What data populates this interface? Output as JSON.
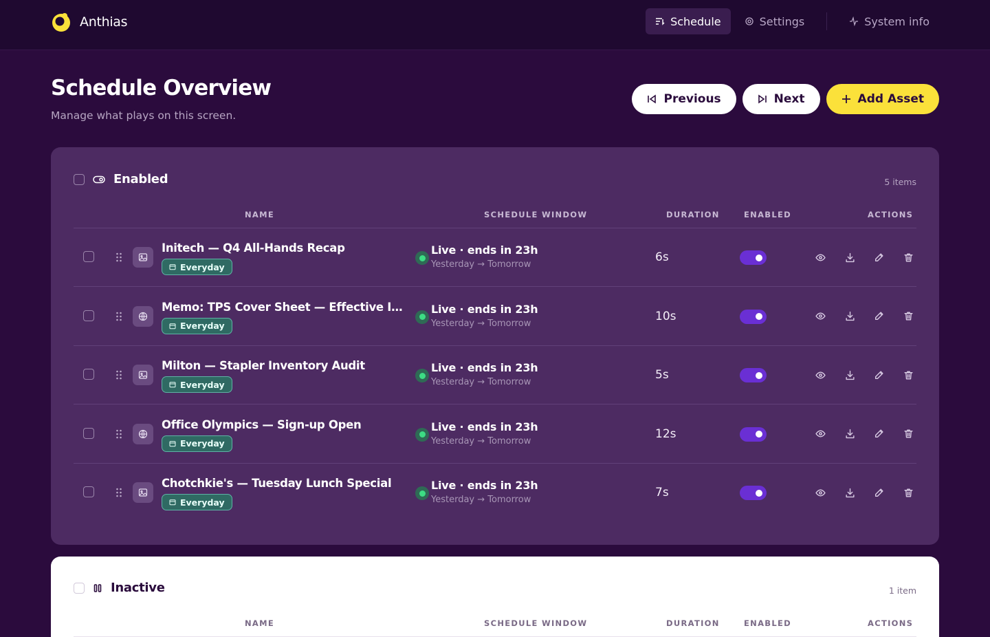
{
  "brand": {
    "name": "Anthias"
  },
  "nav": {
    "schedule": "Schedule",
    "settings": "Settings",
    "system_info": "System info"
  },
  "header": {
    "title": "Schedule Overview",
    "subtitle": "Manage what plays on this screen.",
    "previous_label": "Previous",
    "next_label": "Next",
    "add_label": "Add Asset"
  },
  "columns": {
    "name": "NAME",
    "schedule": "SCHEDULE WINDOW",
    "duration": "DURATION",
    "enabled": "ENABLED",
    "actions": "ACTIONS"
  },
  "enabled_section": {
    "title": "Enabled",
    "count": "5 items",
    "rows": [
      {
        "name": "Initech — Q4 All-Hands Recap",
        "type": "image-icon",
        "badge": "Everyday",
        "status": "Live · ends in 23h",
        "range": "Yesterday → Tomorrow",
        "duration": "6s",
        "enabled": true
      },
      {
        "name": "Memo: TPS Cover Sheet — Effective Immediately",
        "type": "globe-icon",
        "badge": "Everyday",
        "status": "Live · ends in 23h",
        "range": "Yesterday → Tomorrow",
        "duration": "10s",
        "enabled": true
      },
      {
        "name": "Milton — Stapler Inventory Audit",
        "type": "image-icon",
        "badge": "Everyday",
        "status": "Live · ends in 23h",
        "range": "Yesterday → Tomorrow",
        "duration": "5s",
        "enabled": true
      },
      {
        "name": "Office Olympics — Sign-up Open",
        "type": "globe-icon",
        "badge": "Everyday",
        "status": "Live · ends in 23h",
        "range": "Yesterday → Tomorrow",
        "duration": "12s",
        "enabled": true
      },
      {
        "name": "Chotchkie's — Tuesday Lunch Special",
        "type": "image-icon",
        "badge": "Everyday",
        "status": "Live · ends in 23h",
        "range": "Yesterday → Tomorrow",
        "duration": "7s",
        "enabled": true
      }
    ]
  },
  "inactive_section": {
    "title": "Inactive",
    "count": "1 item"
  },
  "colors": {
    "background": "#2b0b3d",
    "topbar": "#1f0930",
    "panel": "#4d2b62",
    "accent_yellow": "#fbe13a",
    "toggle_on": "#6a2fd4",
    "live_green": "#3ddc84",
    "badge_teal": "#2f6a63"
  }
}
